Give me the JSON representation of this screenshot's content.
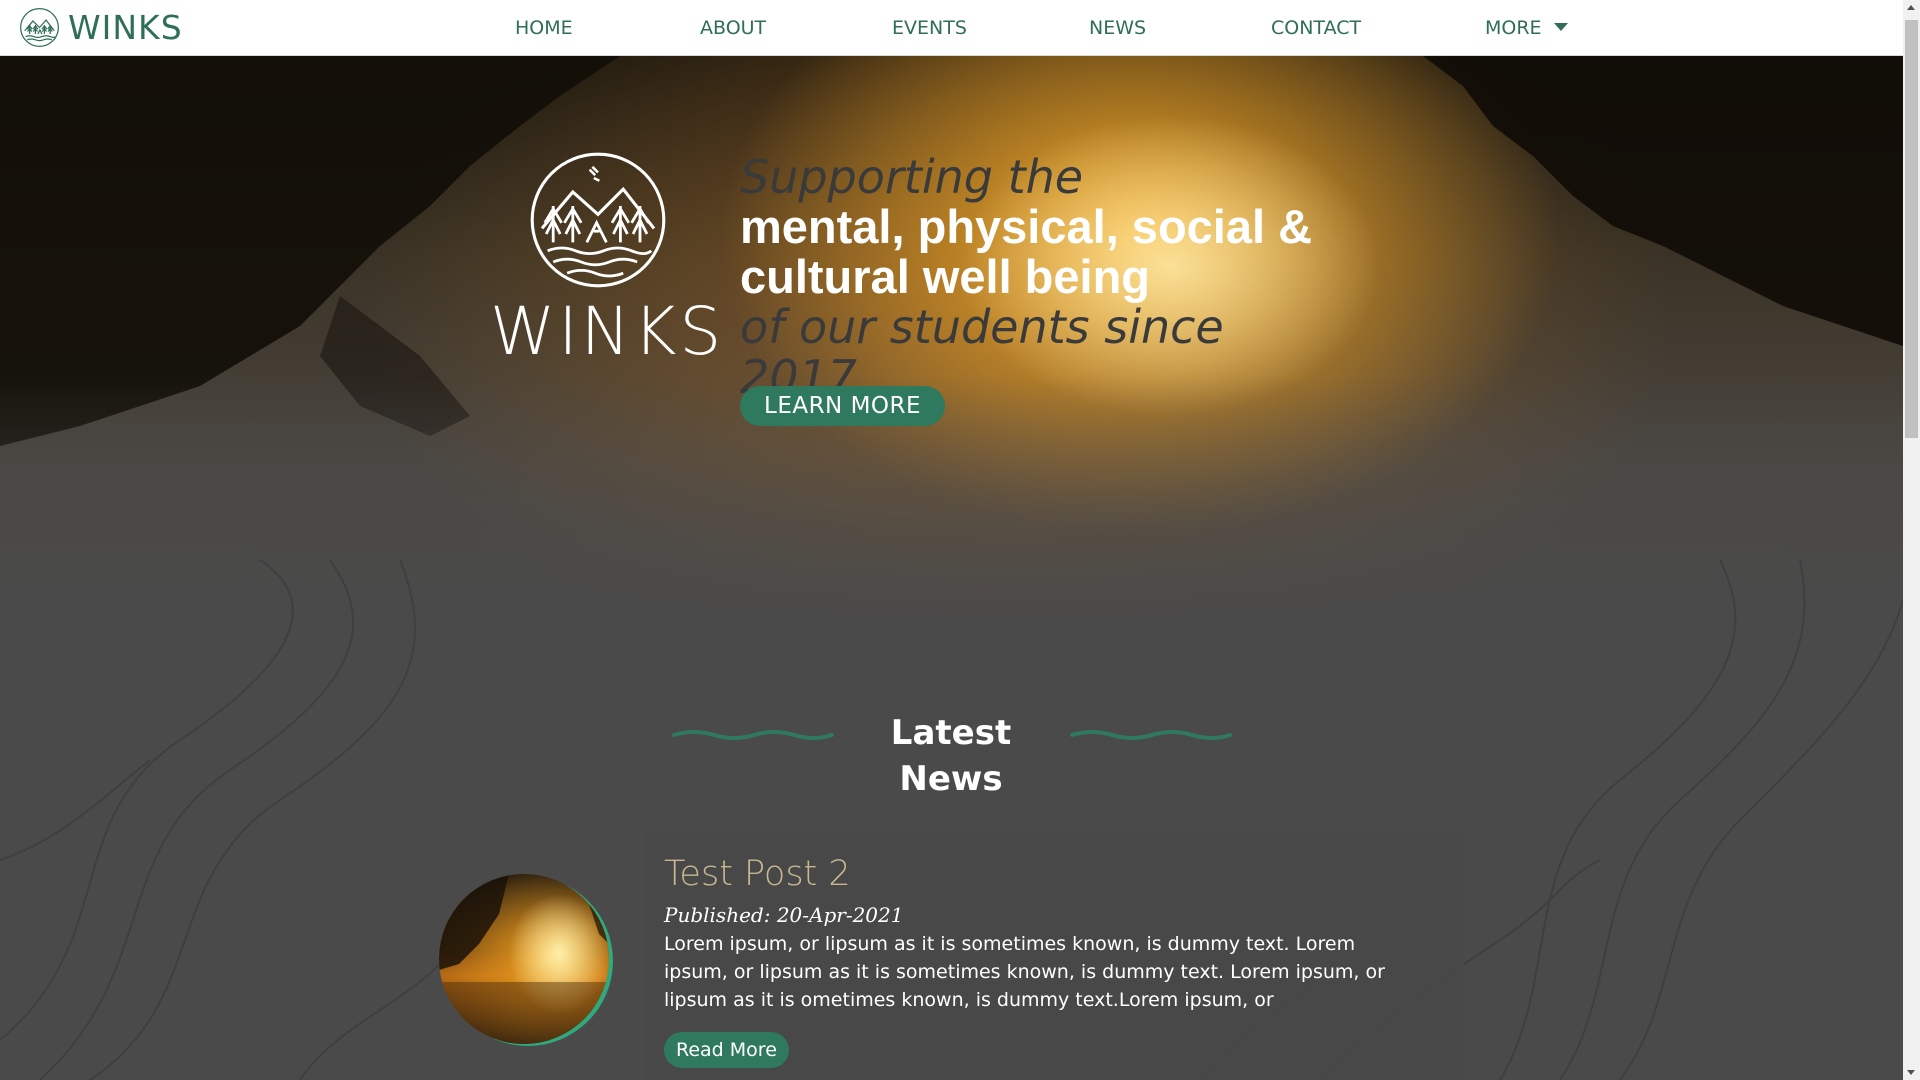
{
  "nav": {
    "brand": "WINKS",
    "items": [
      {
        "label": "HOME"
      },
      {
        "label": "ABOUT"
      },
      {
        "label": "EVENTS"
      },
      {
        "label": "NEWS"
      },
      {
        "label": "CONTACT"
      },
      {
        "label": "MORE"
      }
    ]
  },
  "hero": {
    "logo_text": "WINKS",
    "line1": "Supporting the",
    "line2": "mental, physical, social &",
    "line3": "cultural well being",
    "line4": "of our students since 2017",
    "cta": "LEARN MORE"
  },
  "news": {
    "section_title": "Latest News",
    "posts": [
      {
        "title": "Test Post 2",
        "published": "Published: 20-Apr-2021",
        "excerpt": "Lorem ipsum, or lipsum as it is sometimes known, is dummy text. Lorem ipsum, or lipsum as it is sometimes known, is dummy text. Lorem ipsum, or lipsum as it is ometimes known, is dummy text.Lorem ipsum, or",
        "cta": "Read More"
      }
    ]
  },
  "colors": {
    "brand_green": "#2f6e57",
    "button_green": "#2f7a5e",
    "post_title": "#c8b791",
    "background": "#4a4a4a"
  }
}
